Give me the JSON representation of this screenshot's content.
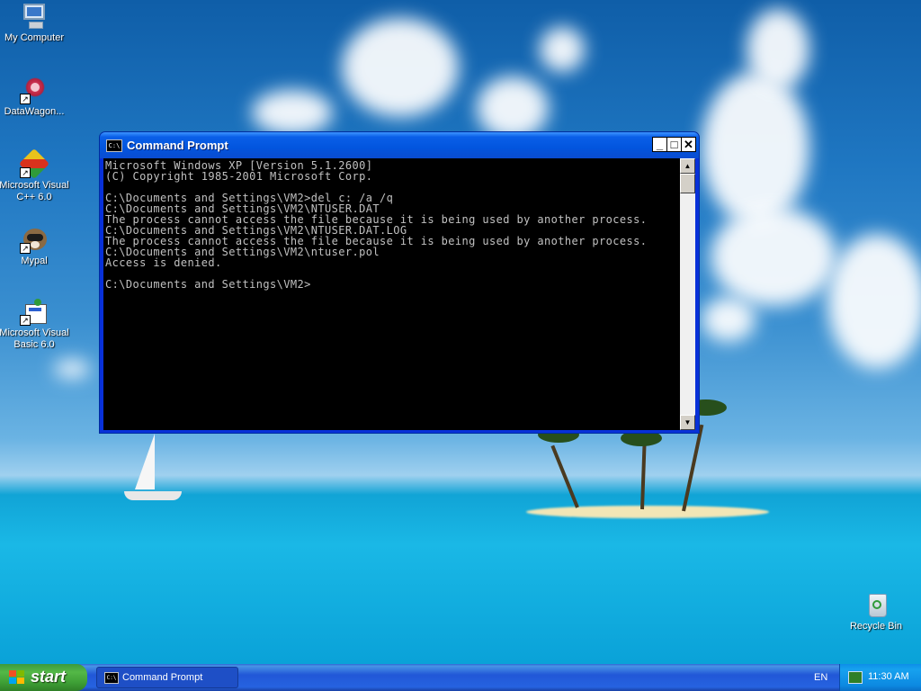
{
  "desktop": {
    "icons": [
      {
        "label": "My Computer",
        "icon": "my-computer-icon"
      },
      {
        "label": "DataWagon...",
        "icon": "datawagon-icon"
      },
      {
        "label": "Microsoft Visual\nC++ 6.0",
        "icon": "visual-cpp-icon"
      },
      {
        "label": "Mypal",
        "icon": "mypal-icon"
      },
      {
        "label": "Microsoft Visual\nBasic 6.0",
        "icon": "visual-basic-icon"
      },
      {
        "label": "Recycle Bin",
        "icon": "recycle-bin-icon"
      }
    ]
  },
  "window": {
    "title": "Command Prompt",
    "app_icon_text": "C:\\",
    "buttons": {
      "minimize": "_",
      "maximize": "□",
      "close": "✕"
    },
    "console_lines": [
      "Microsoft Windows XP [Version 5.1.2600]",
      "(C) Copyright 1985-2001 Microsoft Corp.",
      "",
      "C:\\Documents and Settings\\VM2>del c: /a /q",
      "C:\\Documents and Settings\\VM2\\NTUSER.DAT",
      "The process cannot access the file because it is being used by another process.",
      "C:\\Documents and Settings\\VM2\\NTUSER.DAT.LOG",
      "The process cannot access the file because it is being used by another process.",
      "C:\\Documents and Settings\\VM2\\ntuser.pol",
      "Access is denied.",
      "",
      "C:\\Documents and Settings\\VM2>"
    ],
    "scroll_up": "▲",
    "scroll_down": "▼"
  },
  "taskbar": {
    "start_label": "start",
    "tasks": [
      {
        "label": "Command Prompt",
        "icon_text": "C:\\"
      }
    ],
    "language": "EN",
    "clock": "11:30 AM"
  },
  "colors": {
    "title_bar": "#0a5fe8",
    "console_bg": "#000000",
    "console_text": "#c0c0c0",
    "taskbar": "#2157d7",
    "start_button": "#3d9e35",
    "close_button": "#ffffff"
  }
}
